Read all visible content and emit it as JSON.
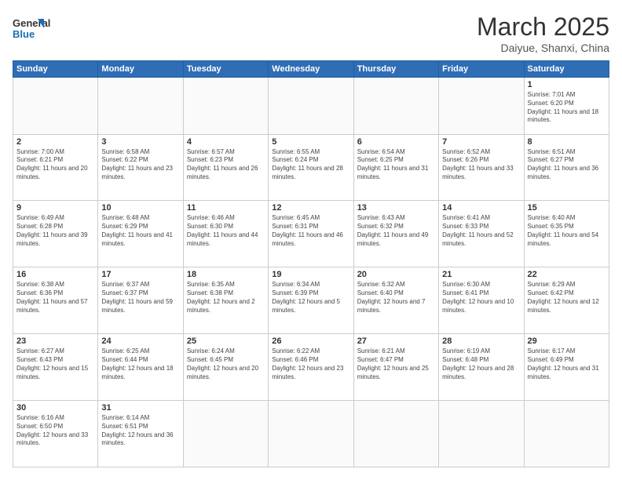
{
  "header": {
    "logo_general": "General",
    "logo_blue": "Blue",
    "month_title": "March 2025",
    "subtitle": "Daiyue, Shanxi, China"
  },
  "weekdays": [
    "Sunday",
    "Monday",
    "Tuesday",
    "Wednesday",
    "Thursday",
    "Friday",
    "Saturday"
  ],
  "weeks": [
    [
      {
        "day": "",
        "info": ""
      },
      {
        "day": "",
        "info": ""
      },
      {
        "day": "",
        "info": ""
      },
      {
        "day": "",
        "info": ""
      },
      {
        "day": "",
        "info": ""
      },
      {
        "day": "",
        "info": ""
      },
      {
        "day": "1",
        "info": "Sunrise: 7:01 AM\nSunset: 6:20 PM\nDaylight: 11 hours and 18 minutes."
      }
    ],
    [
      {
        "day": "2",
        "info": "Sunrise: 7:00 AM\nSunset: 6:21 PM\nDaylight: 11 hours and 20 minutes."
      },
      {
        "day": "3",
        "info": "Sunrise: 6:58 AM\nSunset: 6:22 PM\nDaylight: 11 hours and 23 minutes."
      },
      {
        "day": "4",
        "info": "Sunrise: 6:57 AM\nSunset: 6:23 PM\nDaylight: 11 hours and 26 minutes."
      },
      {
        "day": "5",
        "info": "Sunrise: 6:55 AM\nSunset: 6:24 PM\nDaylight: 11 hours and 28 minutes."
      },
      {
        "day": "6",
        "info": "Sunrise: 6:54 AM\nSunset: 6:25 PM\nDaylight: 11 hours and 31 minutes."
      },
      {
        "day": "7",
        "info": "Sunrise: 6:52 AM\nSunset: 6:26 PM\nDaylight: 11 hours and 33 minutes."
      },
      {
        "day": "8",
        "info": "Sunrise: 6:51 AM\nSunset: 6:27 PM\nDaylight: 11 hours and 36 minutes."
      }
    ],
    [
      {
        "day": "9",
        "info": "Sunrise: 6:49 AM\nSunset: 6:28 PM\nDaylight: 11 hours and 39 minutes."
      },
      {
        "day": "10",
        "info": "Sunrise: 6:48 AM\nSunset: 6:29 PM\nDaylight: 11 hours and 41 minutes."
      },
      {
        "day": "11",
        "info": "Sunrise: 6:46 AM\nSunset: 6:30 PM\nDaylight: 11 hours and 44 minutes."
      },
      {
        "day": "12",
        "info": "Sunrise: 6:45 AM\nSunset: 6:31 PM\nDaylight: 11 hours and 46 minutes."
      },
      {
        "day": "13",
        "info": "Sunrise: 6:43 AM\nSunset: 6:32 PM\nDaylight: 11 hours and 49 minutes."
      },
      {
        "day": "14",
        "info": "Sunrise: 6:41 AM\nSunset: 6:33 PM\nDaylight: 11 hours and 52 minutes."
      },
      {
        "day": "15",
        "info": "Sunrise: 6:40 AM\nSunset: 6:35 PM\nDaylight: 11 hours and 54 minutes."
      }
    ],
    [
      {
        "day": "16",
        "info": "Sunrise: 6:38 AM\nSunset: 6:36 PM\nDaylight: 11 hours and 57 minutes."
      },
      {
        "day": "17",
        "info": "Sunrise: 6:37 AM\nSunset: 6:37 PM\nDaylight: 11 hours and 59 minutes."
      },
      {
        "day": "18",
        "info": "Sunrise: 6:35 AM\nSunset: 6:38 PM\nDaylight: 12 hours and 2 minutes."
      },
      {
        "day": "19",
        "info": "Sunrise: 6:34 AM\nSunset: 6:39 PM\nDaylight: 12 hours and 5 minutes."
      },
      {
        "day": "20",
        "info": "Sunrise: 6:32 AM\nSunset: 6:40 PM\nDaylight: 12 hours and 7 minutes."
      },
      {
        "day": "21",
        "info": "Sunrise: 6:30 AM\nSunset: 6:41 PM\nDaylight: 12 hours and 10 minutes."
      },
      {
        "day": "22",
        "info": "Sunrise: 6:29 AM\nSunset: 6:42 PM\nDaylight: 12 hours and 12 minutes."
      }
    ],
    [
      {
        "day": "23",
        "info": "Sunrise: 6:27 AM\nSunset: 6:43 PM\nDaylight: 12 hours and 15 minutes."
      },
      {
        "day": "24",
        "info": "Sunrise: 6:25 AM\nSunset: 6:44 PM\nDaylight: 12 hours and 18 minutes."
      },
      {
        "day": "25",
        "info": "Sunrise: 6:24 AM\nSunset: 6:45 PM\nDaylight: 12 hours and 20 minutes."
      },
      {
        "day": "26",
        "info": "Sunrise: 6:22 AM\nSunset: 6:46 PM\nDaylight: 12 hours and 23 minutes."
      },
      {
        "day": "27",
        "info": "Sunrise: 6:21 AM\nSunset: 6:47 PM\nDaylight: 12 hours and 25 minutes."
      },
      {
        "day": "28",
        "info": "Sunrise: 6:19 AM\nSunset: 6:48 PM\nDaylight: 12 hours and 28 minutes."
      },
      {
        "day": "29",
        "info": "Sunrise: 6:17 AM\nSunset: 6:49 PM\nDaylight: 12 hours and 31 minutes."
      }
    ],
    [
      {
        "day": "30",
        "info": "Sunrise: 6:16 AM\nSunset: 6:50 PM\nDaylight: 12 hours and 33 minutes."
      },
      {
        "day": "31",
        "info": "Sunrise: 6:14 AM\nSunset: 6:51 PM\nDaylight: 12 hours and 36 minutes."
      },
      {
        "day": "",
        "info": ""
      },
      {
        "day": "",
        "info": ""
      },
      {
        "day": "",
        "info": ""
      },
      {
        "day": "",
        "info": ""
      },
      {
        "day": "",
        "info": ""
      }
    ]
  ]
}
